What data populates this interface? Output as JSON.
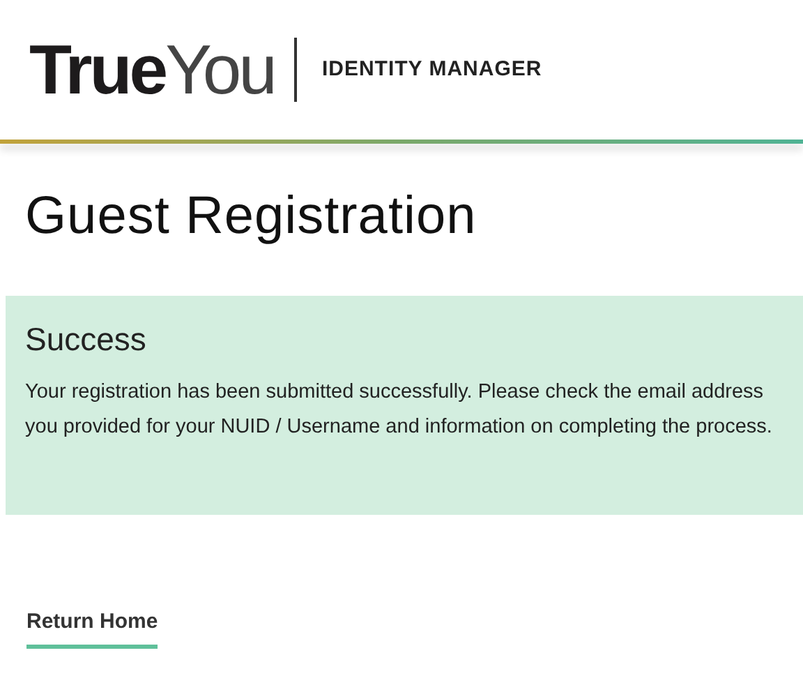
{
  "header": {
    "logo": {
      "first": "True",
      "second": "You"
    },
    "subtitle": "IDENTITY MANAGER"
  },
  "title": "Guest Registration",
  "alert": {
    "kind": "success",
    "heading": "Success",
    "message": "Your registration has been submitted successfully. Please check the email address you provided for your NUID / Username and information on completing the process."
  },
  "link": "Return Home"
}
